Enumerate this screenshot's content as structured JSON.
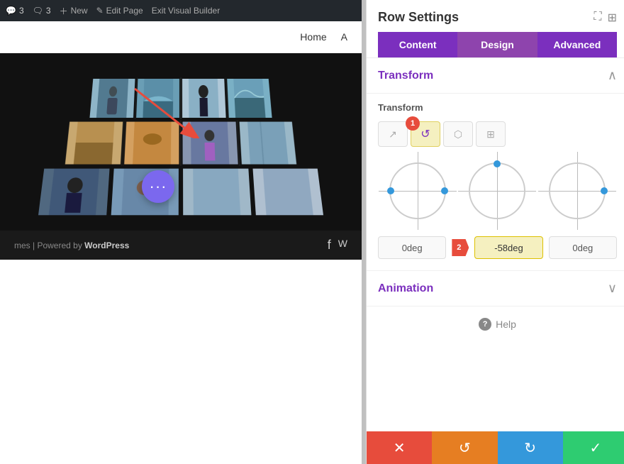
{
  "topbar": {
    "items": [
      {
        "label": "3",
        "icon": "bubble-icon"
      },
      {
        "label": "3",
        "icon": "comment-icon"
      },
      {
        "label": "New",
        "icon": "plus-icon"
      },
      {
        "label": "Edit Page",
        "icon": "pencil-icon"
      },
      {
        "label": "Exit Visual Builder",
        "icon": "exit-icon"
      }
    ]
  },
  "nav": {
    "links": [
      "Home",
      "A"
    ]
  },
  "footer": {
    "text": "mes | Powered by",
    "brand": "WordPress",
    "icons": [
      "f",
      "W"
    ]
  },
  "panel": {
    "title": "Row Settings",
    "tabs": [
      {
        "label": "Content"
      },
      {
        "label": "Design"
      },
      {
        "label": "Advanced"
      }
    ],
    "active_tab": "Design",
    "sections": {
      "transform": {
        "title": "Transform",
        "label": "Transform",
        "icons": [
          {
            "name": "move-icon",
            "symbol": "↗",
            "badge": null
          },
          {
            "name": "rotate-icon",
            "symbol": "↺",
            "badge": "1",
            "active": true
          },
          {
            "name": "skew-icon",
            "symbol": "⬡",
            "badge": null
          },
          {
            "name": "scale-icon",
            "symbol": "⊞",
            "badge": null
          }
        ],
        "inputs": [
          {
            "id": "x-rotate",
            "value": "0deg"
          },
          {
            "id": "y-rotate",
            "value": "-58deg",
            "highlighted": true
          },
          {
            "id": "z-rotate",
            "value": "0deg"
          }
        ]
      },
      "animation": {
        "title": "Animation",
        "collapsed": true
      }
    },
    "help": "Help",
    "bottom_buttons": [
      {
        "label": "✕",
        "color": "red",
        "name": "cancel-button"
      },
      {
        "label": "↺",
        "color": "orange",
        "name": "undo-button"
      },
      {
        "label": "↻",
        "color": "blue",
        "name": "redo-button"
      },
      {
        "label": "✓",
        "color": "green",
        "name": "save-button"
      }
    ]
  }
}
